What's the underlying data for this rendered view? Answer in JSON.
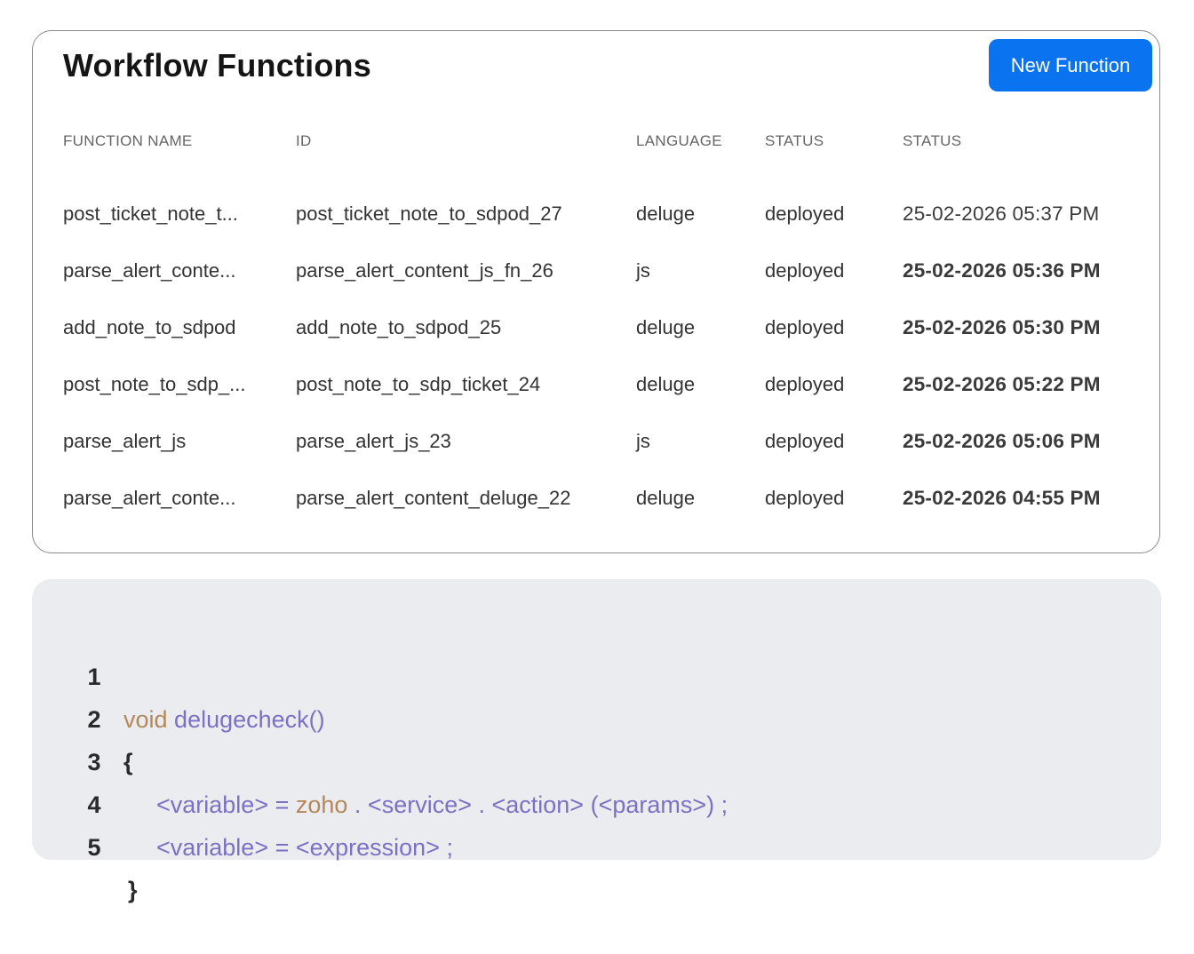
{
  "card": {
    "title": "Workflow Functions",
    "new_button_label": "New Function"
  },
  "table": {
    "headers": [
      "FUNCTION NAME",
      "ID",
      "LANGUAGE",
      "STATUS",
      "STATUS"
    ],
    "rows": [
      {
        "name": "post_ticket_note_t...",
        "id": "post_ticket_note_to_sdpod_27",
        "language": "deluge",
        "status": "deployed",
        "date": "25-02-2026 05:37 PM"
      },
      {
        "name": "parse_alert_conte...",
        "id": "parse_alert_content_js_fn_26",
        "language": "js",
        "status": "deployed",
        "date": "25-02-2026 05:36 PM"
      },
      {
        "name": "add_note_to_sdpod",
        "id": "add_note_to_sdpod_25",
        "language": "deluge",
        "status": "deployed",
        "date": "25-02-2026 05:30 PM"
      },
      {
        "name": "post_note_to_sdp_...",
        "id": "post_note_to_sdp_ticket_24",
        "language": "deluge",
        "status": "deployed",
        "date": "25-02-2026 05:22 PM"
      },
      {
        "name": "parse_alert_js",
        "id": "parse_alert_js_23",
        "language": "js",
        "status": "deployed",
        "date": "25-02-2026 05:06 PM"
      },
      {
        "name": "parse_alert_conte...",
        "id": "parse_alert_content_deluge_22",
        "language": "deluge",
        "status": "deployed",
        "date": "25-02-2026 04:55 PM"
      }
    ]
  },
  "code": {
    "line_numbers": [
      "1",
      "2",
      "3",
      "4",
      "5"
    ],
    "l1_keyword": "void",
    "l1_func": "delugecheck()",
    "l2_brace": "{",
    "l3_a": "<variable> = ",
    "l3_zoho": "zoho",
    "l3_b": " . <service> . <action> (<params>) ;",
    "l4": "<variable> = <expression> ;",
    "l5_brace": "}"
  }
}
